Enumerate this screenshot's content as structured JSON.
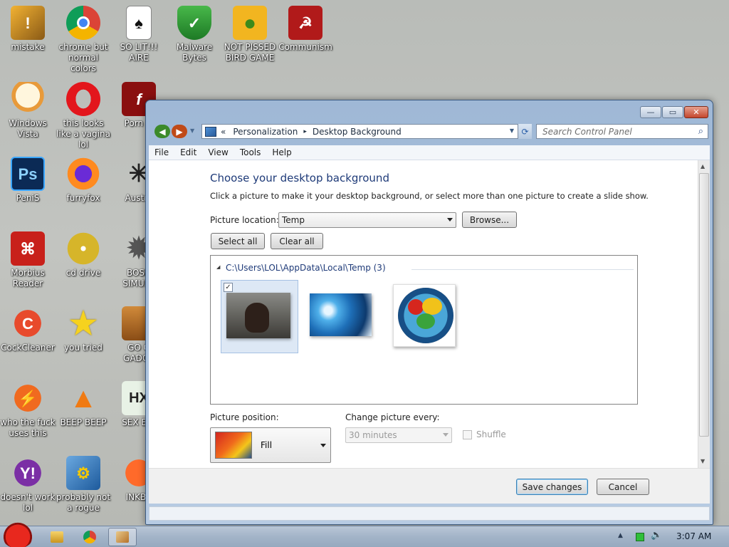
{
  "desktop": {
    "icons": [
      {
        "label": "mistake",
        "icon": "mistake-icon"
      },
      {
        "label": "chrome but normal colors",
        "icon": "chrome-icon"
      },
      {
        "label": "SO LIT!!! AIRE",
        "icon": "solitaire-icon"
      },
      {
        "label": "Malware Bytes",
        "icon": "malwarebytes-icon"
      },
      {
        "label": "NOT PISSED BIRD GAME",
        "icon": "bad-piggies-icon"
      },
      {
        "label": "Communism",
        "icon": "communism-icon"
      },
      {
        "label": "Windows Vista",
        "icon": "egg-icon"
      },
      {
        "label": "this looks like a vagina lol",
        "icon": "opera-icon"
      },
      {
        "label": "Porn Pl",
        "icon": "flash-icon"
      },
      {
        "label": "PeniS",
        "icon": "photoshop-icon"
      },
      {
        "label": "furryfox",
        "icon": "firefox-icon"
      },
      {
        "label": "Austra",
        "icon": "spider-icon"
      },
      {
        "label": "Morbius Reader",
        "icon": "acrobat-icon"
      },
      {
        "label": "cd drive",
        "icon": "cd-icon"
      },
      {
        "label": "BOSN SIMULA",
        "icon": "gear-ball-icon"
      },
      {
        "label": "CockCleaner",
        "icon": "ccleaner-icon"
      },
      {
        "label": "you tried",
        "icon": "star-icon"
      },
      {
        "label": "GO G GADGE",
        "icon": "briefcase-icon"
      },
      {
        "label": "who the fuck uses this",
        "icon": "winamp-icon"
      },
      {
        "label": "BEEP BEEP",
        "icon": "vlc-icon"
      },
      {
        "label": "SEX EDI",
        "icon": "hex-editor-icon"
      },
      {
        "label": "doesn't work lol",
        "icon": "yahoo-icon"
      },
      {
        "label": "probably not a rogue",
        "icon": "gears-icon"
      },
      {
        "label": "INKBA",
        "icon": "inkball-icon"
      }
    ]
  },
  "window": {
    "nav_back": "◀",
    "nav_forward": "▶",
    "address": {
      "prefix": "«",
      "crumb1": "Personalization",
      "sep": "▸",
      "crumb2": "Desktop Background"
    },
    "search_placeholder": "Search Control Panel",
    "controls": {
      "minimize": "—",
      "maximize": "▭",
      "close": "✕"
    },
    "menu": [
      "File",
      "Edit",
      "View",
      "Tools",
      "Help"
    ]
  },
  "page": {
    "heading": "Choose your desktop background",
    "description": "Click a picture to make it your desktop background, or select more than one picture to create a slide show.",
    "picture_location_label": "Picture location:",
    "picture_location_value": "Temp",
    "browse": "Browse...",
    "select_all": "Select all",
    "clear_all": "Clear all",
    "folder_path": "C:\\Users\\LOL\\AppData\\Local\\Temp (3)",
    "checkbox_mark": "✓",
    "picture_position_label": "Picture position:",
    "picture_position_value": "Fill",
    "change_every_label": "Change picture every:",
    "change_every_value": "30 minutes",
    "shuffle": "Shuffle"
  },
  "footer": {
    "save": "Save changes",
    "cancel": "Cancel"
  },
  "taskbar": {
    "time": "3:07 AM"
  },
  "colors": {
    "heading": "#1e3a78",
    "accent": "#3399ff"
  }
}
